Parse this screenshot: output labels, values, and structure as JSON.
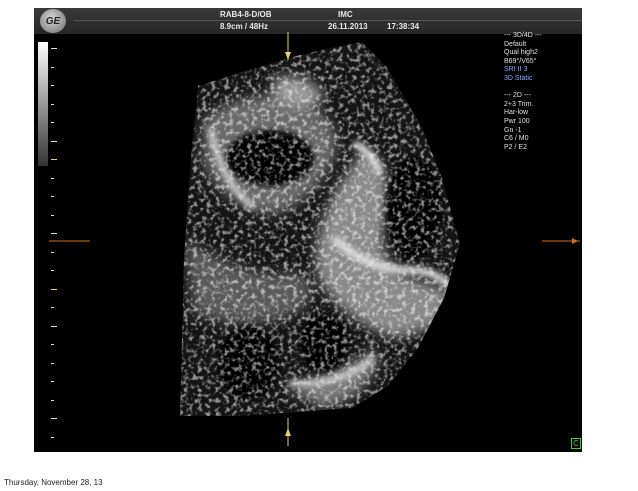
{
  "header": {
    "probe": "RAB4-8-D/OB",
    "depth_freq": "8.9cm / 48Hz",
    "institution": "IMC",
    "date": "26.11.2013",
    "time": "17:38:34"
  },
  "logo_icon": "ge-logo",
  "info_panel": {
    "lines": [
      {
        "text": "--- 3D/4D ---",
        "color": "#e0e0e0"
      },
      {
        "text": "Default",
        "color": "#e0e0e0"
      },
      {
        "text": "Qual high2",
        "color": "#e0e0e0"
      },
      {
        "text": "B69°/V65°",
        "color": "#e0e0e0"
      },
      {
        "text": "SRI II 3",
        "color": "#8fa8ff"
      },
      {
        "text": "3D Static",
        "color": "#8fa8ff"
      },
      {
        "text": "",
        "color": "#e0e0e0"
      },
      {
        "text": "--- 2D ---",
        "color": "#e0e0e0"
      },
      {
        "text": "2+3 Trim.",
        "color": "#e0e0e0"
      },
      {
        "text": "Har-low",
        "color": "#e0e0e0"
      },
      {
        "text": "Pwr 100",
        "color": "#e0e0e0"
      },
      {
        "text": "Gn -1",
        "color": "#e0e0e0"
      },
      {
        "text": "C6 / M0",
        "color": "#e0e0e0"
      },
      {
        "text": "P2 / E2",
        "color": "#e0e0e0"
      }
    ]
  },
  "frame_marker": "C",
  "footer": {
    "date": "Thursday, November 28, 13"
  },
  "colors": {
    "marker_orange": "#d4701e",
    "marker_yellow": "#e3d27a",
    "frame_green": "#3fcf3f"
  }
}
